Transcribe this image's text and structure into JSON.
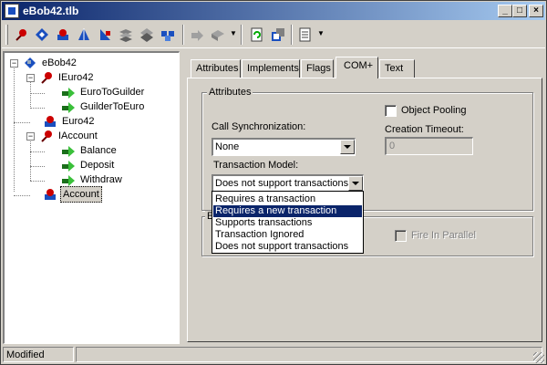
{
  "window": {
    "title": "eBob42.tlb"
  },
  "toolbar": {
    "tools": [
      "interface-icon",
      "dispinterface-icon",
      "coclass-icon",
      "enum-icon",
      "alias-icon",
      "record-icon",
      "union-icon",
      "module-icon",
      "method-icon",
      "property-icon",
      "refresh-icon",
      "register-icon",
      "export-icon"
    ]
  },
  "tree": {
    "root": "eBob42",
    "items": [
      "IEuro42",
      "EuroToGuilder",
      "GuilderToEuro",
      "Euro42",
      "IAccount",
      "Balance",
      "Deposit",
      "Withdraw",
      "Account"
    ],
    "expander_minus": "−",
    "selected": "Account"
  },
  "tabs": [
    "Attributes",
    "Implements",
    "Flags",
    "COM+",
    "Text"
  ],
  "active_tab": "COM+",
  "attributes": {
    "group_title": "Attributes",
    "call_sync_label": "Call Synchronization:",
    "call_sync_value": "None",
    "transaction_label": "Transaction Model:",
    "transaction_value": "Does not support transactions",
    "object_pooling_label": "Object Pooling",
    "creation_timeout_label": "Creation Timeout:",
    "creation_timeout_value": "0"
  },
  "second_group": {
    "title_fragment": "E",
    "fire_in_parallel_label": "Fire In Parallel"
  },
  "dropdown": {
    "options": [
      "Requires a transaction",
      "Requires a new transaction",
      "Supports transactions",
      "Transaction Ignored",
      "Does not support transactions"
    ],
    "highlighted": "Requires a new transaction"
  },
  "statusbar": {
    "text": "Modified"
  },
  "colors": {
    "selection": "#0a246a",
    "titlebar_start": "#0a246a",
    "titlebar_end": "#a6caf0",
    "face": "#d4d0c8"
  }
}
